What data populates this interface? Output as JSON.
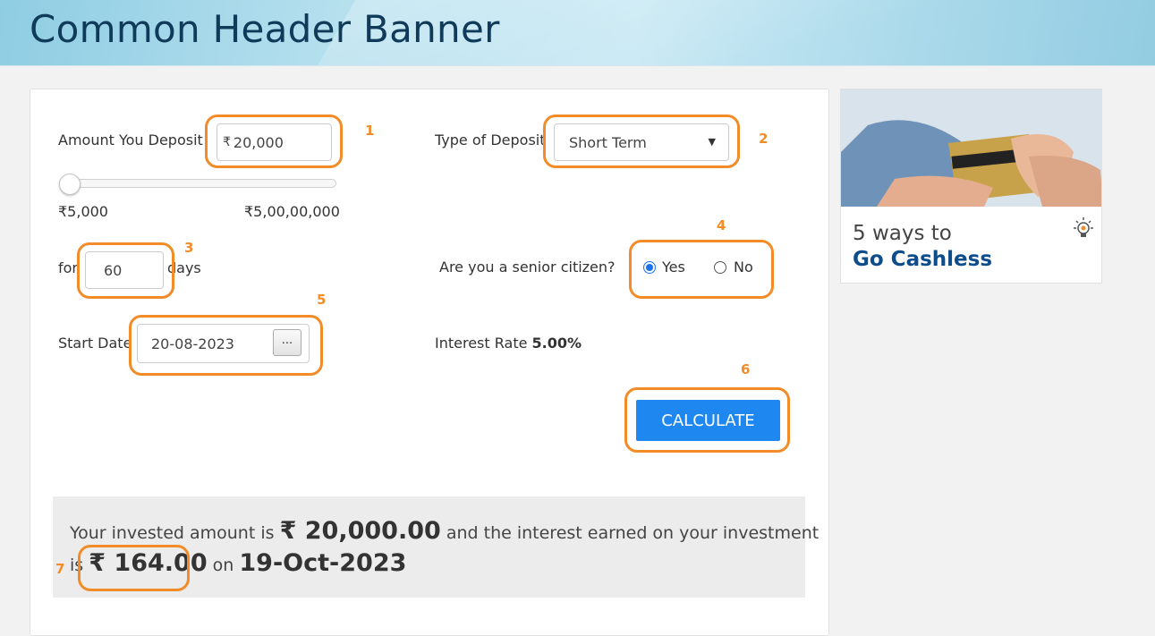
{
  "banner": {
    "title": "Common Header Banner"
  },
  "form": {
    "amount_label": "Amount You Deposit",
    "amount_prefix": "₹",
    "amount_value": "20,000",
    "slider_min": "₹5,000",
    "slider_max": "₹5,00,00,000",
    "slider_fraction": 0.003,
    "deposit_type_label": "Type of Deposit",
    "deposit_type_value": "Short Term",
    "for_label": "for",
    "days_value": "60",
    "days_label": "days",
    "senior_label": "Are you a senior citizen?",
    "senior_yes": "Yes",
    "senior_no": "No",
    "senior_selected": "Yes",
    "start_date_label": "Start Date",
    "start_date_value": "20-08-2023",
    "date_button": "...",
    "interest_label": "Interest Rate",
    "interest_value": "5.00%",
    "calculate_label": "CALCULATE"
  },
  "result": {
    "text1": "Your invested amount is",
    "invested": "₹ 20,000.00",
    "text2": "and the interest earned on your investment",
    "text3": "is",
    "interest": "₹ 164.00",
    "text4": "on",
    "date": "19-Oct-2023"
  },
  "annotations": [
    "1",
    "2",
    "3",
    "4",
    "5",
    "6",
    "7"
  ],
  "ad": {
    "line1": "5 ways to",
    "line2": "Go Cashless"
  },
  "colors": {
    "highlight": "#f28c28",
    "button": "#1e88f0",
    "ad_text": "#0d4d8c"
  }
}
